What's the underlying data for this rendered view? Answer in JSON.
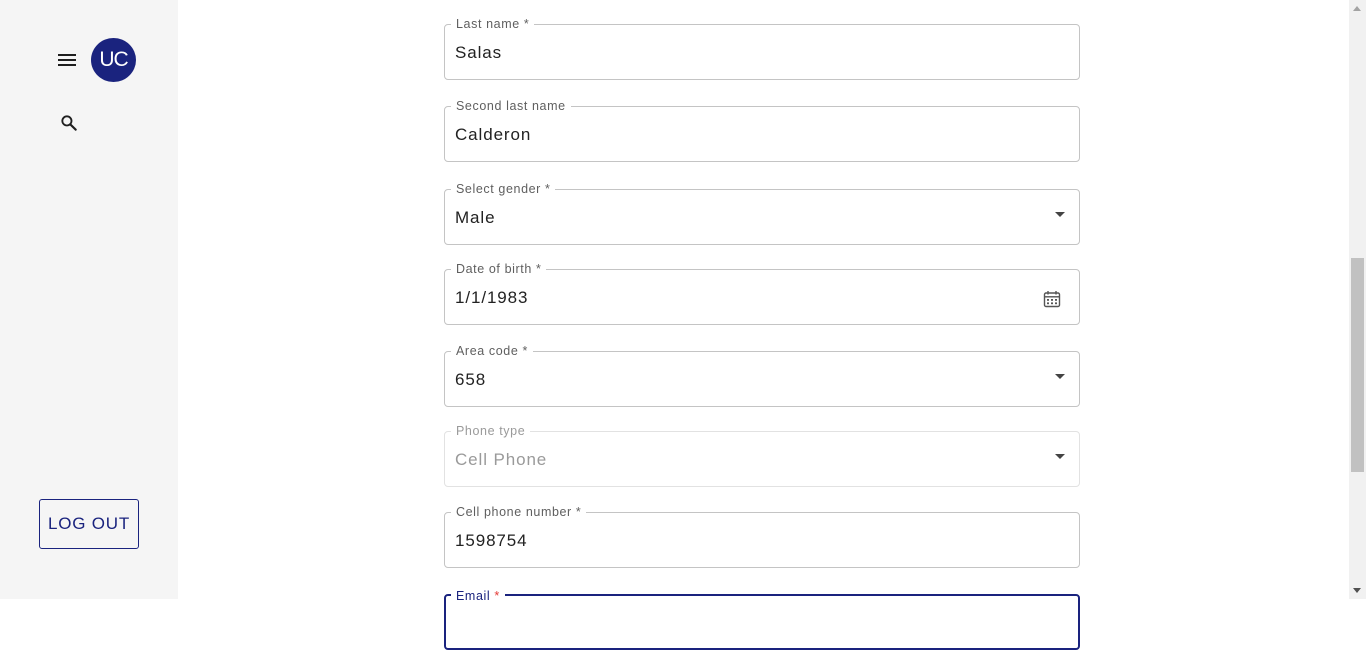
{
  "sidebar": {
    "avatar_initials": "UC",
    "menu_icon": "hamburger-menu-icon",
    "search_icon": "search-icon",
    "logout_label": "LOG OUT"
  },
  "form": {
    "last_name": {
      "label": "Last name",
      "required": "*",
      "value": "Salas"
    },
    "second_last_name": {
      "label": "Second last name",
      "value": "Calderon"
    },
    "gender": {
      "label": "Select gender",
      "required": "*",
      "value": "Male"
    },
    "date_of_birth": {
      "label": "Date of birth",
      "required": "*",
      "value": "1/1/1983",
      "icon": "calendar-icon"
    },
    "area_code": {
      "label": "Area code",
      "required": "*",
      "value": "658"
    },
    "phone_type": {
      "label": "Phone type",
      "value": "Cell Phone"
    },
    "cell_phone": {
      "label": "Cell phone number",
      "required": "*",
      "value": "1598754"
    },
    "email": {
      "label": "Email",
      "required": "*",
      "value": ""
    }
  },
  "colors": {
    "primary": "#1a237e",
    "required_focus": "#e53935"
  }
}
